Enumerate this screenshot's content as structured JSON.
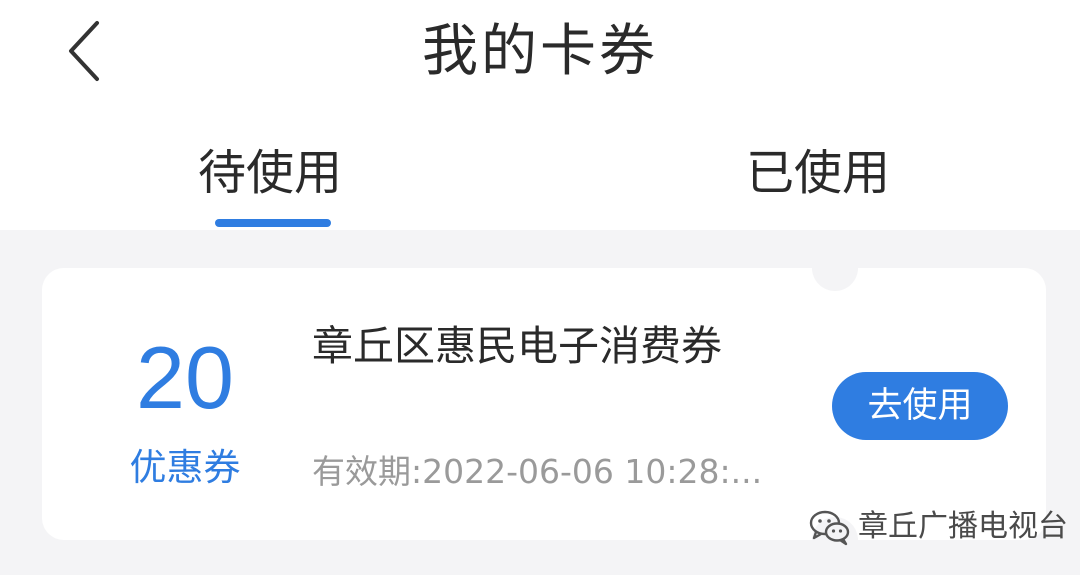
{
  "header": {
    "title": "我的卡券",
    "back_icon": "chevron-left-icon"
  },
  "tabs": [
    {
      "label": "待使用",
      "active": true
    },
    {
      "label": "已使用",
      "active": false
    }
  ],
  "coupon": {
    "amount": "20",
    "amount_label": "优惠券",
    "name": "章丘区惠民电子消费券",
    "validity": "有效期:2022-06-06 10:28:...",
    "action_label": "去使用"
  },
  "watermark": {
    "icon": "wechat-icon",
    "text": "章丘广播电视台"
  },
  "colors": {
    "accent": "#2f7de1",
    "background": "#f4f4f6",
    "card": "#ffffff",
    "text": "#2a2a2a",
    "muted": "#9a9a9a"
  }
}
